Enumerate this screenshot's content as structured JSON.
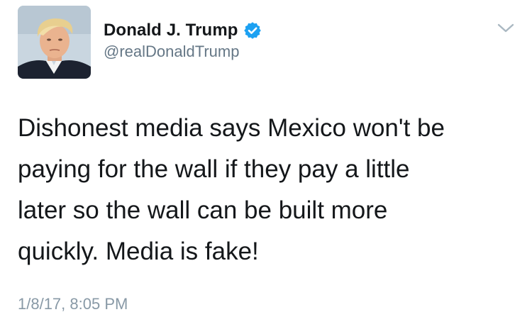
{
  "author": {
    "display_name": "Donald J. Trump",
    "handle": "@realDonaldTrump",
    "verified_icon": "verified-badge-icon",
    "avatar_icon": "profile-photo"
  },
  "tweet": {
    "text_lines": [
      "Dishonest media says Mexico won't be",
      "paying for the wall if they pay a little",
      "later so the wall can be built more",
      "quickly. Media is fake!"
    ],
    "timestamp": "1/8/17, 8:05 PM"
  },
  "controls": {
    "menu_icon": "chevron-down-icon"
  },
  "colors": {
    "text": "#14171a",
    "secondary": "#657786",
    "timestamp": "#8899a6",
    "verified_blue": "#1da1f2",
    "caret": "#aab8c2"
  }
}
